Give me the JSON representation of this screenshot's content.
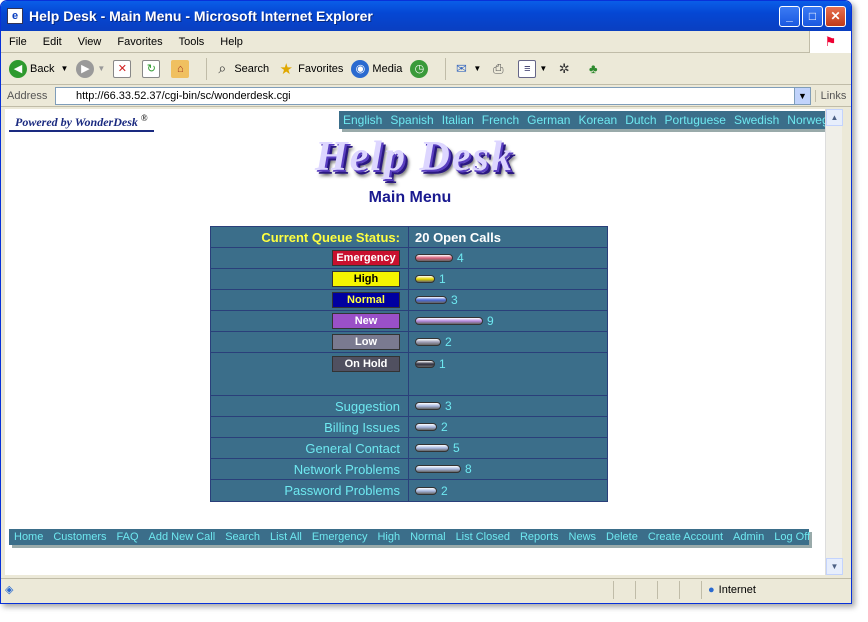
{
  "window": {
    "title": "Help Desk - Main Menu - Microsoft Internet Explorer",
    "minimize": "_",
    "maximize": "□",
    "close": "✕"
  },
  "menu": [
    "File",
    "Edit",
    "View",
    "Favorites",
    "Tools",
    "Help"
  ],
  "toolbar": {
    "back": "Back",
    "search": "Search",
    "favorites": "Favorites",
    "media": "Media"
  },
  "address": {
    "label": "Address",
    "url": "http://66.33.52.37/cgi-bin/sc/wonderdesk.cgi",
    "links": "Links"
  },
  "page": {
    "powered_by": "Powered by WonderDesk",
    "powered_mark": "®",
    "logo": "Help Desk",
    "title": "Main Menu",
    "languages": [
      "English",
      "Spanish",
      "Italian",
      "French",
      "German",
      "Korean",
      "Dutch",
      "Portuguese",
      "Swedish",
      "Norwegian"
    ],
    "queue_status_label": "Current Queue Status:",
    "open_calls": "20 Open Calls",
    "priorities": [
      {
        "label": "Emergency",
        "count": "4",
        "count_value": 4,
        "bg": "#c8102e",
        "fg": "#ffffff",
        "bar": "#d8607a"
      },
      {
        "label": "High",
        "count": "1",
        "count_value": 1,
        "bg": "#f5f500",
        "fg": "#000000",
        "bar": "#e6d800"
      },
      {
        "label": "Normal",
        "count": "3",
        "count_value": 3,
        "bg": "#0000a0",
        "fg": "#ffff40",
        "bar": "#4a6ad8"
      },
      {
        "label": "New",
        "count": "9",
        "count_value": 9,
        "bg": "#9a50c8",
        "fg": "#ffffff",
        "bar": "#b88ae0"
      },
      {
        "label": "Low",
        "count": "2",
        "count_value": 2,
        "bg": "#7a7a90",
        "fg": "#ffffff",
        "bar": "#a0a0b8"
      },
      {
        "label": "On Hold",
        "count": "1",
        "count_value": 1,
        "bg": "#505060",
        "fg": "#ffffff",
        "bar": "#303040"
      }
    ],
    "categories": [
      {
        "label": "Suggestion",
        "count": "3",
        "count_value": 3
      },
      {
        "label": "Billing Issues",
        "count": "2",
        "count_value": 2
      },
      {
        "label": "General Contact",
        "count": "5",
        "count_value": 5
      },
      {
        "label": "Network Problems",
        "count": "8",
        "count_value": 8
      },
      {
        "label": "Password Problems",
        "count": "2",
        "count_value": 2
      }
    ],
    "nav": [
      "Home",
      "Customers",
      "FAQ",
      "Add New Call",
      "Search",
      "List All",
      "Emergency",
      "High",
      "Normal",
      "List Closed",
      "Reports",
      "News",
      "Delete",
      "Create Account",
      "Admin",
      "Log Off"
    ]
  },
  "status": {
    "zone": "Internet"
  }
}
